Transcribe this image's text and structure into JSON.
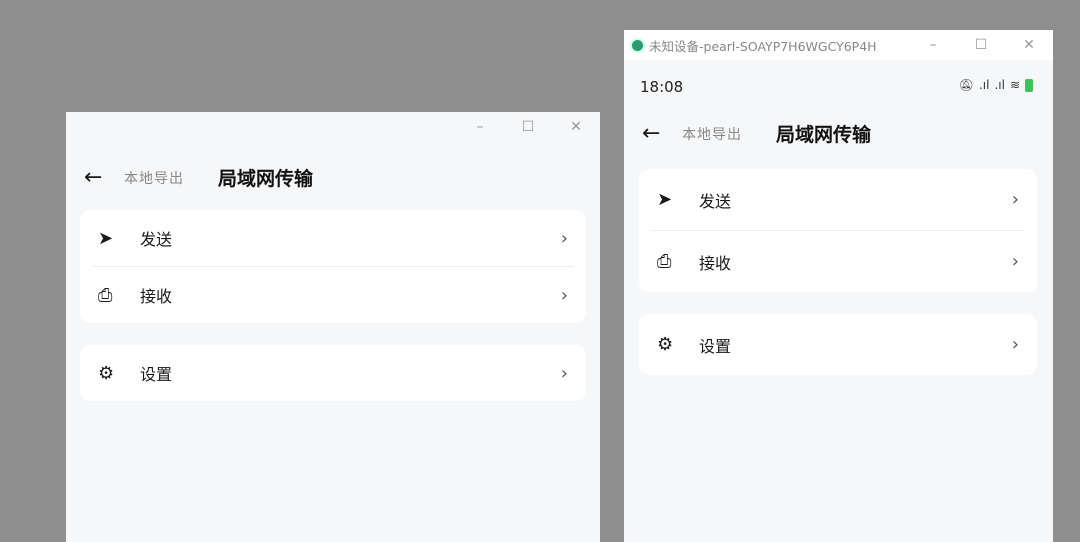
{
  "left_window": {
    "controls": [
      "–",
      "☐",
      "✕"
    ],
    "header": {
      "back": "←",
      "subtitle": "本地导出",
      "title": "局域网传输"
    },
    "items": [
      {
        "icon": "send-icon",
        "label": "发送"
      },
      {
        "icon": "receive-icon",
        "label": "接收"
      },
      {
        "icon": "gear-icon",
        "label": "设置"
      }
    ],
    "chevron": "›"
  },
  "right_window": {
    "title": "未知设备-pearl-SOAYP7H6WGCY6P4H",
    "controls": [
      "–",
      "☐",
      "✕"
    ],
    "status_bar": {
      "time": "18:08",
      "icons": [
        "mute-icon",
        "signal-icon",
        "signal-icon",
        "wifi-icon",
        "battery-icon"
      ]
    },
    "header": {
      "back": "←",
      "subtitle": "本地导出",
      "title": "局域网传输"
    },
    "items": [
      {
        "icon": "send-icon",
        "label": "发送"
      },
      {
        "icon": "receive-icon",
        "label": "接收"
      },
      {
        "icon": "gear-icon",
        "label": "设置"
      }
    ],
    "chevron": "›"
  },
  "colors": {
    "desktop": "#8e8e8e",
    "window_bg": "#f6f7f9",
    "battery": "#3cc35a"
  }
}
